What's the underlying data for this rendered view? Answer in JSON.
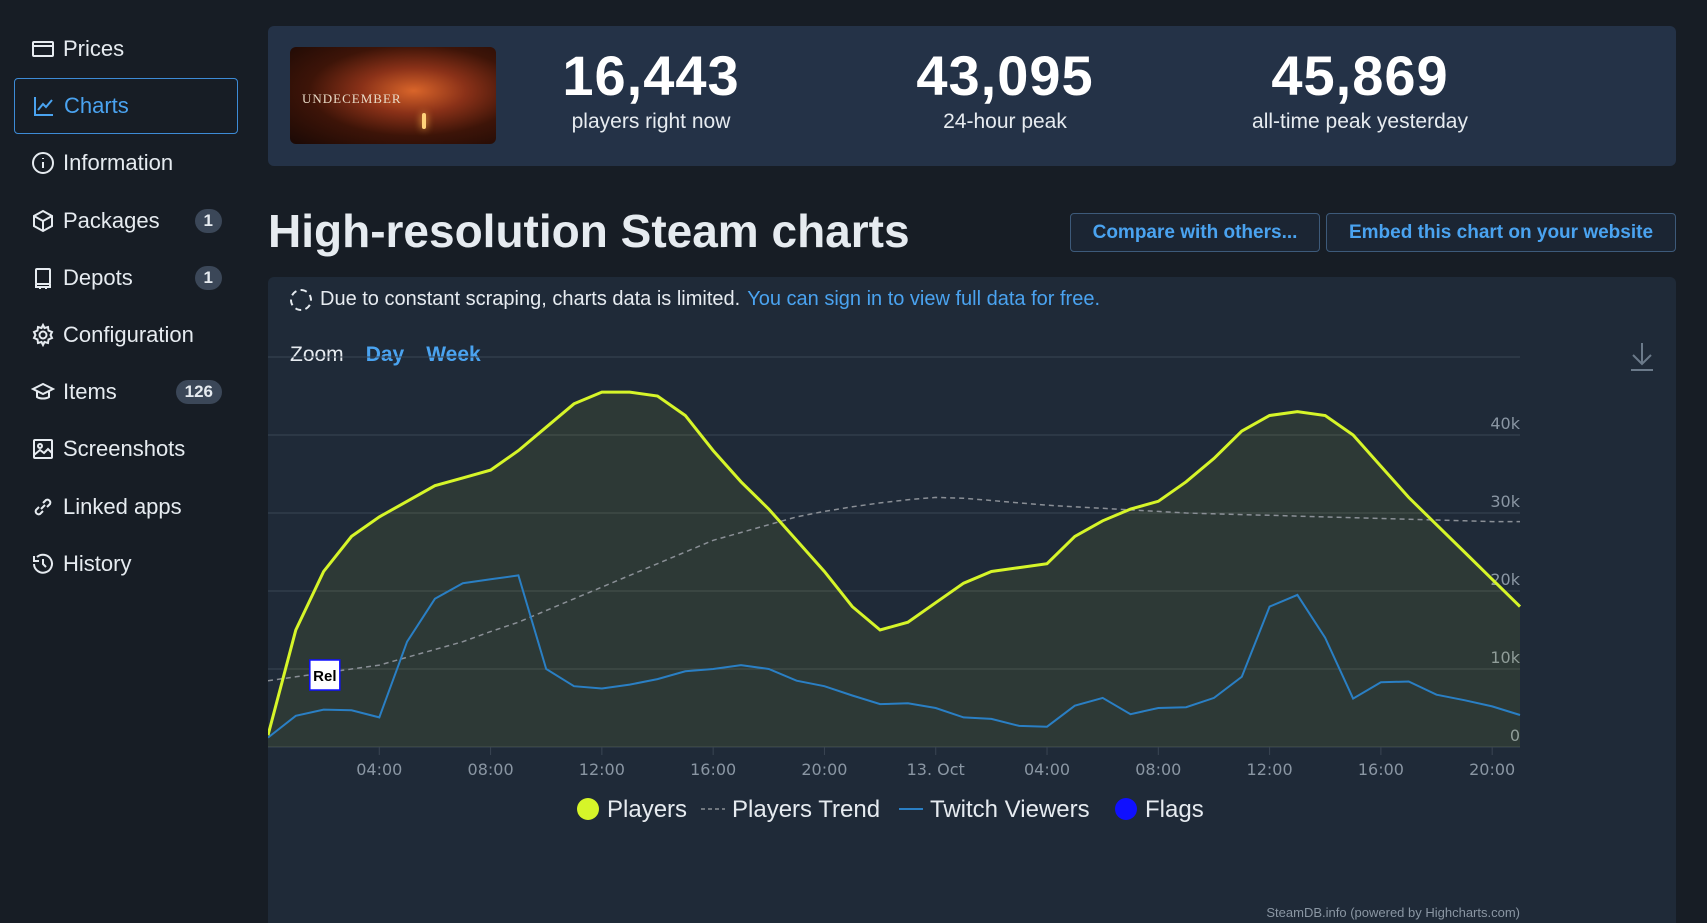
{
  "sidebar": {
    "items": [
      {
        "label": "Prices",
        "icon": "prices-icon",
        "badge": ""
      },
      {
        "label": "Charts",
        "icon": "charts-icon",
        "badge": "",
        "active": true
      },
      {
        "label": "Information",
        "icon": "info-icon",
        "badge": ""
      },
      {
        "label": "Packages",
        "icon": "package-icon",
        "badge": "1"
      },
      {
        "label": "Depots",
        "icon": "depot-icon",
        "badge": "1"
      },
      {
        "label": "Configuration",
        "icon": "gear-icon",
        "badge": ""
      },
      {
        "label": "Items",
        "icon": "graduation-cap-icon",
        "badge": "126"
      },
      {
        "label": "Screenshots",
        "icon": "image-icon",
        "badge": ""
      },
      {
        "label": "Linked apps",
        "icon": "link-icon",
        "badge": ""
      },
      {
        "label": "History",
        "icon": "history-icon",
        "badge": ""
      }
    ]
  },
  "header": {
    "game_logo_text": "UNDECEMBER",
    "stats": [
      {
        "value": "16,443",
        "label": "players right now"
      },
      {
        "value": "43,095",
        "label": "24-hour peak"
      },
      {
        "value": "45,869",
        "label": "all-time peak yesterday"
      }
    ]
  },
  "main": {
    "title": "High-resolution Steam charts",
    "compare_button": "Compare with others...",
    "embed_button": "Embed this chart on your website",
    "notice_text": "Due to constant scraping, charts data is limited.",
    "notice_link": "You can sign in to view full data for free.",
    "zoom_label": "Zoom",
    "zoom_day": "Day",
    "zoom_week": "Week"
  },
  "colors": {
    "players": "#d6f529",
    "trend": "#8a8f96",
    "twitch": "#2a7fc4",
    "flags": "#1010ff",
    "accent": "#4aa3f0"
  },
  "chart_data": {
    "type": "line",
    "x": [
      "00:00",
      "01:00",
      "02:00",
      "03:00",
      "04:00",
      "05:00",
      "06:00",
      "07:00",
      "08:00",
      "09:00",
      "10:00",
      "11:00",
      "12:00",
      "13:00",
      "14:00",
      "15:00",
      "16:00",
      "17:00",
      "18:00",
      "19:00",
      "20:00",
      "21:00",
      "22:00",
      "23:00",
      "00:00",
      "01:00",
      "02:00",
      "03:00",
      "04:00",
      "05:00",
      "06:00",
      "07:00",
      "08:00",
      "09:00",
      "10:00",
      "11:00",
      "12:00",
      "13:00",
      "14:00",
      "15:00",
      "16:00",
      "17:00",
      "18:00",
      "19:00",
      "20:00",
      "21:00"
    ],
    "x_tick_labels": [
      "04:00",
      "08:00",
      "12:00",
      "16:00",
      "20:00",
      "13. Oct",
      "04:00",
      "08:00",
      "12:00",
      "16:00",
      "20:00"
    ],
    "y_tick_labels": [
      "0",
      "10k",
      "20k",
      "30k",
      "40k"
    ],
    "ylim": [
      0,
      50000
    ],
    "grid": true,
    "legend_position": "bottom-center",
    "series": [
      {
        "name": "Players",
        "values": [
          1500,
          15000,
          22500,
          27000,
          29500,
          31500,
          33500,
          34500,
          35500,
          38000,
          41000,
          44000,
          45500,
          45500,
          45000,
          42500,
          38000,
          34000,
          30500,
          26500,
          22500,
          18000,
          15000,
          16000,
          18500,
          21000,
          22500,
          23000,
          23500,
          27000,
          29000,
          30500,
          31500,
          34000,
          37000,
          40500,
          42500,
          43000,
          42500,
          40000,
          36000,
          32000,
          28500,
          25000,
          21500,
          18000
        ]
      },
      {
        "name": "Players Trend",
        "values": [
          8500,
          9000,
          9500,
          10000,
          10500,
          11500,
          12500,
          13500,
          14800,
          16000,
          17500,
          19000,
          20500,
          22000,
          23500,
          25000,
          26500,
          27500,
          28500,
          29500,
          30200,
          30800,
          31300,
          31700,
          32000,
          31900,
          31600,
          31300,
          31000,
          30800,
          30600,
          30400,
          30200,
          30000,
          29900,
          29800,
          29700,
          29600,
          29500,
          29400,
          29300,
          29200,
          29100,
          29000,
          28900,
          28900
        ]
      },
      {
        "name": "Twitch Viewers",
        "values": [
          1200,
          4000,
          4800,
          4700,
          3800,
          13500,
          19000,
          21000,
          21500,
          22000,
          10000,
          7800,
          7500,
          8000,
          8700,
          9700,
          10000,
          10500,
          10000,
          8500,
          7800,
          6600,
          5500,
          5600,
          5000,
          3800,
          3600,
          2700,
          2600,
          5300,
          6300,
          4200,
          5000,
          5100,
          6300,
          9000,
          18000,
          19500,
          14000,
          6200,
          8300,
          8400,
          6700,
          6000,
          5200,
          4100
        ]
      },
      {
        "name": "Flags",
        "values": []
      }
    ],
    "annotations": [
      {
        "label": "Rel",
        "x": "01:00"
      }
    ],
    "credit": "SteamDB.info (powered by Highcharts.com)"
  }
}
